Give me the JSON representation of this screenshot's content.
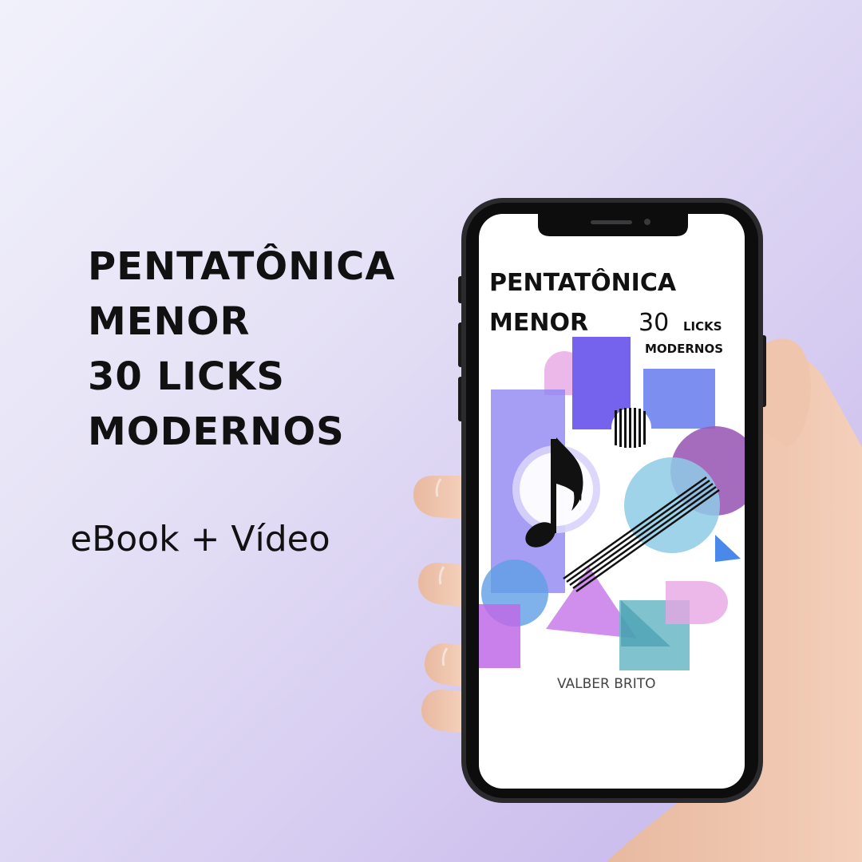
{
  "promo": {
    "headline": [
      "PENTATÔNICA",
      "MENOR",
      "30 LICKS",
      "MODERNOS"
    ],
    "subtitle": "eBook + Vídeo"
  },
  "cover": {
    "title_line1": "PENTATÔNICA",
    "title_line2": "MENOR",
    "licks_number": "30",
    "licks_word": "LICKS",
    "licks_subtitle": "MODERNOS",
    "author": "VALBER BRITO"
  },
  "colors": {
    "text": "#111111",
    "purple": "#7c6cf0",
    "lavender": "#a79df2",
    "pink": "#e6a6e3",
    "magenta": "#c06ae6",
    "sky": "#8ecbe6",
    "teal": "#6ab9c6",
    "violet": "#9b5bb5",
    "blue": "#4a88ea"
  }
}
